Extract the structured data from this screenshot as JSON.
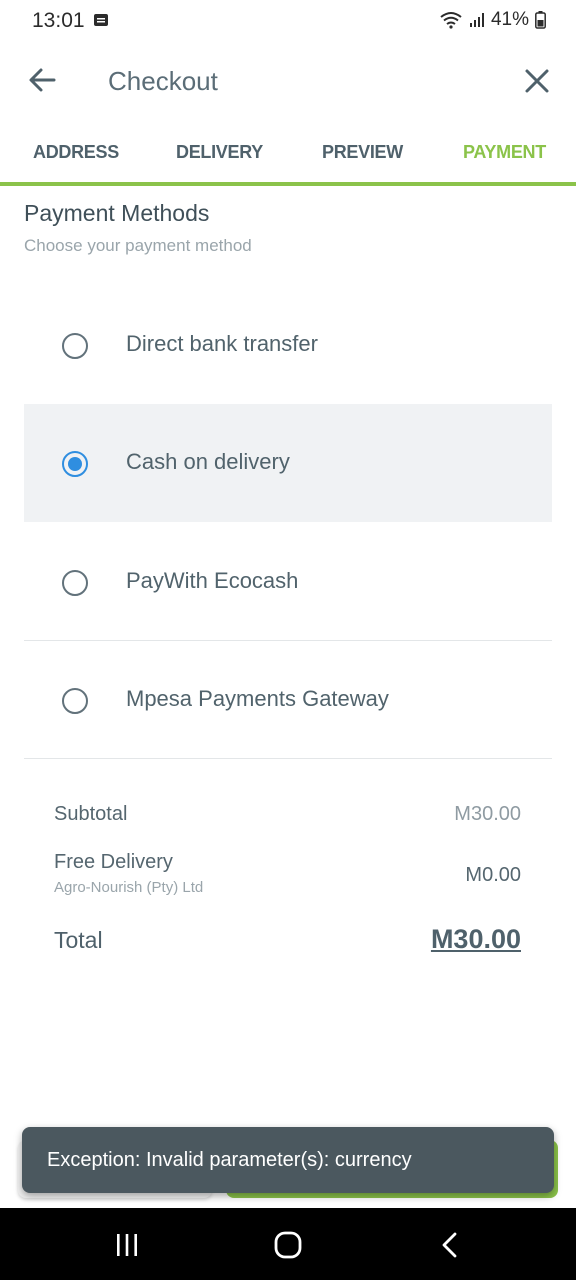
{
  "status_bar": {
    "time": "13:01",
    "battery": "41%"
  },
  "app_bar": {
    "title": "Checkout"
  },
  "tabs": [
    {
      "label": "ADDRESS",
      "active": false
    },
    {
      "label": "DELIVERY",
      "active": false
    },
    {
      "label": "PREVIEW",
      "active": false
    },
    {
      "label": "PAYMENT",
      "active": true
    }
  ],
  "payment": {
    "title": "Payment Methods",
    "subtitle": "Choose your payment method",
    "options": [
      {
        "label": "Direct bank transfer",
        "selected": false
      },
      {
        "label": "Cash on delivery",
        "selected": true
      },
      {
        "label": "PayWith Ecocash",
        "selected": false
      },
      {
        "label": "Mpesa Payments Gateway",
        "selected": false
      }
    ]
  },
  "summary": {
    "subtotal_label": "Subtotal",
    "subtotal_value": "M30.00",
    "delivery_label": "Free Delivery",
    "delivery_vendor": "Agro-Nourish (Pty) Ltd",
    "delivery_value": "M0.00",
    "total_label": "Total",
    "total_value": "M30.00"
  },
  "snackbar": {
    "message": "Exception: Invalid parameter(s): currency"
  },
  "colors": {
    "accent": "#8bc34a",
    "radio_selected": "#2f8ee0",
    "snackbar_bg": "#4b585f"
  },
  "icons": {
    "back": "arrow-left-icon",
    "close": "close-icon",
    "wifi": "wifi-icon",
    "signal": "signal-icon",
    "battery": "battery-icon",
    "nav_recents": "recents-icon",
    "nav_home": "home-icon",
    "nav_back": "chevron-left-icon"
  }
}
